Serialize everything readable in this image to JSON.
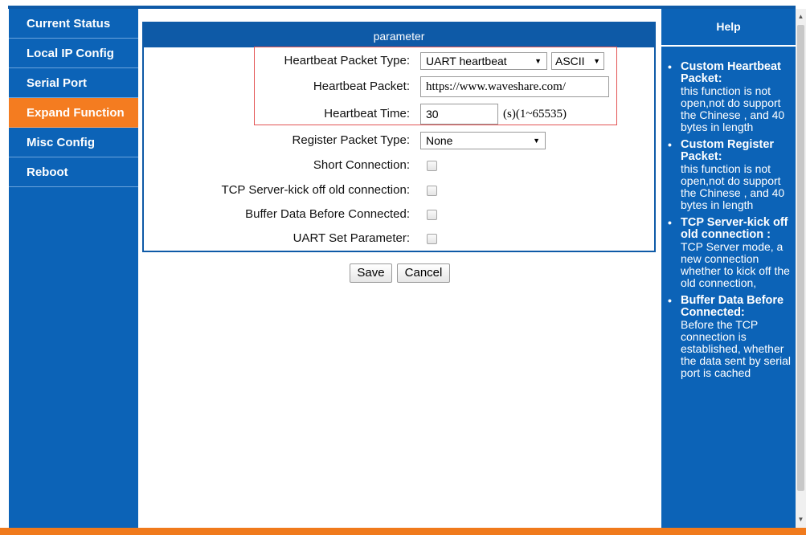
{
  "sidebar": {
    "items": [
      {
        "label": "Current Status"
      },
      {
        "label": "Local IP Config"
      },
      {
        "label": "Serial Port"
      },
      {
        "label": "Expand Function"
      },
      {
        "label": "Misc Config"
      },
      {
        "label": "Reboot"
      }
    ],
    "active_index": 3
  },
  "panel": {
    "title": "parameter",
    "heartbeat_type": {
      "label": "Heartbeat Packet Type:",
      "value": "UART heartbeat",
      "format": "ASCII"
    },
    "heartbeat_packet": {
      "label": "Heartbeat Packet:",
      "value": "https://www.waveshare.com/"
    },
    "heartbeat_time": {
      "label": "Heartbeat Time:",
      "value": "30",
      "unit": "(s)(1~65535)"
    },
    "register_type": {
      "label": "Register Packet Type:",
      "value": "None"
    },
    "short_connection": {
      "label": "Short Connection:"
    },
    "tcp_kick": {
      "label": "TCP Server-kick off old connection:"
    },
    "buffer_data": {
      "label": "Buffer Data Before Connected:"
    },
    "uart_set": {
      "label": "UART Set Parameter:"
    }
  },
  "buttons": {
    "save": "Save",
    "cancel": "Cancel"
  },
  "help": {
    "title": "Help",
    "items": [
      {
        "title": "Custom Heartbeat Packet:",
        "text": "this function is not open,not do support the Chinese , and 40 bytes in length"
      },
      {
        "title": "Custom Register Packet:",
        "text": "this function is not open,not do support the Chinese , and 40 bytes in length"
      },
      {
        "title": "TCP Server-kick off old connection :",
        "text": "TCP Server mode, a new connection whether to kick off the old connection,"
      },
      {
        "title": "Buffer Data Before Connected:",
        "text": "Before the TCP connection is established, whether the data sent by serial port is cached"
      }
    ]
  },
  "colors": {
    "nav_bg": "#0c63b7",
    "active": "#f47c20",
    "header": "#0e5aa7",
    "highlight": "#e35454"
  }
}
